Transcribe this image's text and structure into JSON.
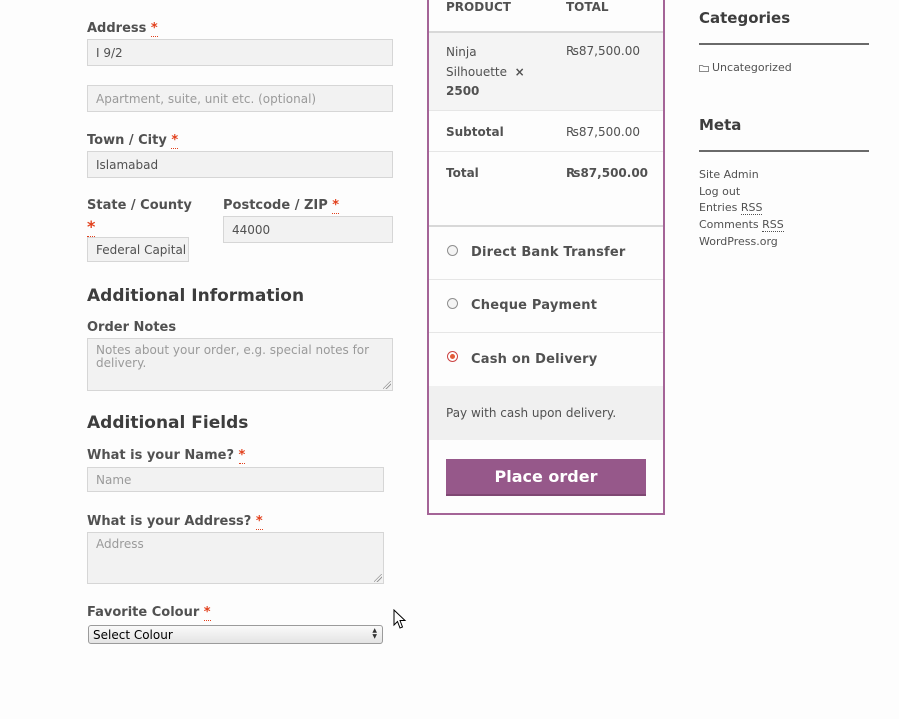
{
  "billing": {
    "address_label": "Address",
    "address_value": "I 9/2",
    "apartment_placeholder": "Apartment, suite, unit etc. (optional)",
    "city_label": "Town / City",
    "city_value": "Islamabad",
    "state_label": "State / County",
    "state_value": "Federal Capital",
    "postcode_label": "Postcode / ZIP",
    "postcode_value": "44000",
    "required_mark": "*"
  },
  "additional_info": {
    "heading": "Additional Information",
    "notes_label": "Order Notes",
    "notes_placeholder": "Notes about your order, e.g. special notes for delivery."
  },
  "additional_fields": {
    "heading": "Additional Fields",
    "name_label": "What is your Name?",
    "name_placeholder": "Name",
    "address_label": "What is your Address?",
    "address_placeholder": "Address",
    "colour_label": "Favorite Colour",
    "colour_selected": "Select Colour"
  },
  "order": {
    "col_product": "PRODUCT",
    "col_total": "TOTAL",
    "item_name_line1": "Ninja",
    "item_name_line2": "Silhouette",
    "item_times": "×",
    "item_qty": "2500",
    "item_total": "₨87,500.00",
    "subtotal_label": "Subtotal",
    "subtotal_value": "₨87,500.00",
    "total_label": "Total",
    "total_value": "₨87,500.00"
  },
  "payment": {
    "methods": [
      {
        "label": "Direct Bank Transfer",
        "selected": false
      },
      {
        "label": "Cheque Payment",
        "selected": false
      },
      {
        "label": "Cash on Delivery",
        "selected": true
      }
    ],
    "description": "Pay with cash upon delivery.",
    "place_order_label": "Place order",
    "accent_color": "#96588a"
  },
  "sidebar": {
    "categories_title": "Categories",
    "categories": [
      "Uncategorized"
    ],
    "meta_title": "Meta",
    "meta_links": {
      "site_admin": "Site Admin",
      "log_out": "Log out",
      "entries": "Entries",
      "comments": "Comments",
      "rss": "RSS",
      "wordpress": "WordPress.org"
    },
    "folder_icon": "folder-icon"
  }
}
